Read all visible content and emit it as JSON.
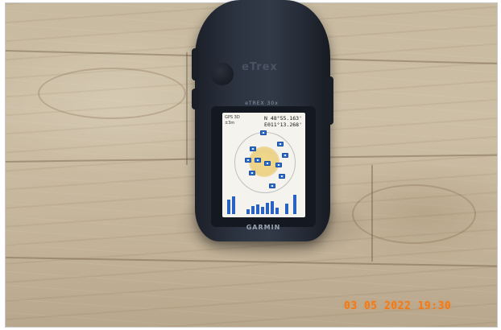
{
  "photo": {
    "subject": "handheld GPS receiver on wooden floor",
    "timestamp": "03 05 2022 19:30"
  },
  "device": {
    "brand": "GARMIN",
    "model": "eTrex",
    "model_label": "eTREX 30x",
    "screen": {
      "status_line_1": "GPS 3D",
      "status_line_2": "±3m",
      "latitude": "N 48°55.163'",
      "longitude": "E011°13.268'"
    }
  },
  "colors": {
    "device_body": "#2c3340",
    "screen_bg": "#f4f3ee",
    "satellite_signal": "#2a62c4",
    "sky_fix_area": "#ecd28a",
    "timestamp": "#f07a18"
  },
  "icons": {
    "satellite": "satellite-marker-icon",
    "signal_bar": "signal-bar"
  }
}
